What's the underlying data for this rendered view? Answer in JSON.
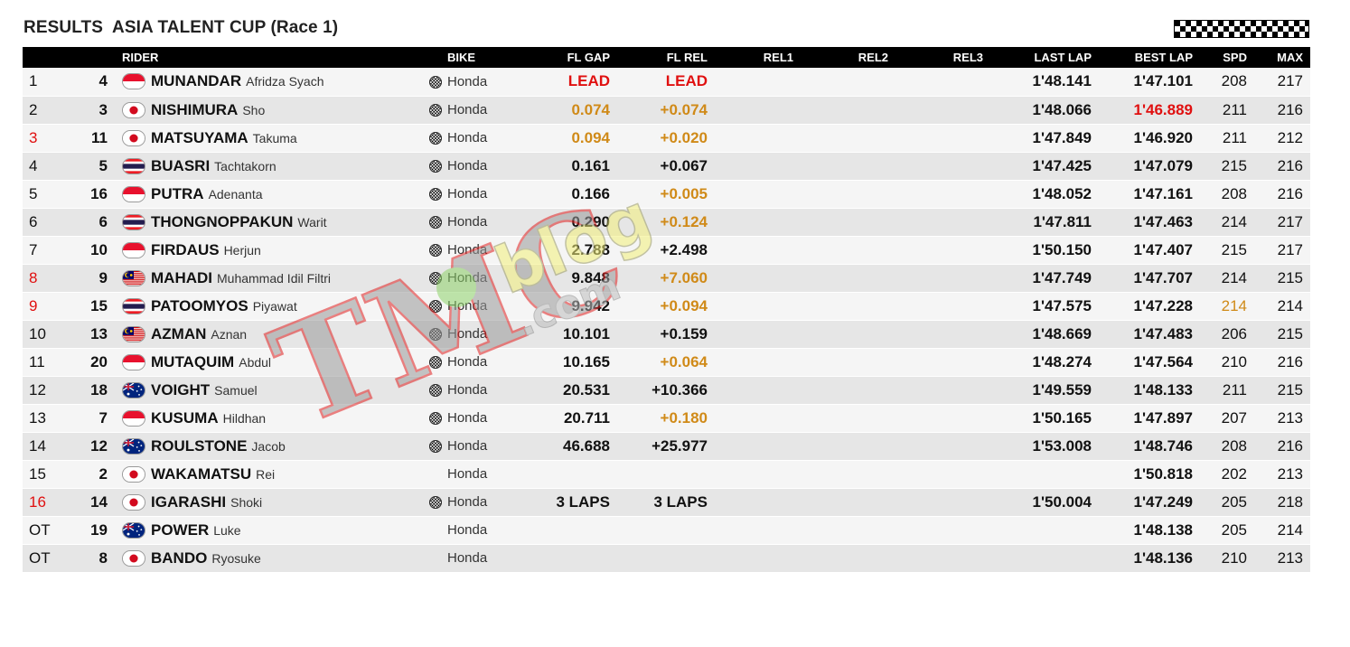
{
  "header": {
    "title_main": "RESULTS  ASIA TALENT CUP",
    "title_race": "(Race 1)"
  },
  "columns": {
    "rider": "RIDER",
    "bike": "BIKE",
    "fl_gap": "FL GAP",
    "fl_rel": "FL REL",
    "rel1": "REL1",
    "rel2": "REL2",
    "rel3": "REL3",
    "last_lap": "LAST LAP",
    "best_lap": "BEST LAP",
    "spd": "SPD",
    "max": "MAX"
  },
  "colors": {
    "lead_red": "#e01010",
    "improve_orange": "#d08a18",
    "header_bg": "#000000"
  },
  "rows": [
    {
      "pos": "1",
      "num": "4",
      "surname": "MUNANDAR",
      "given": "Afridza Syach",
      "nation": "indonesia",
      "bike": "Honda",
      "gap": "LEAD",
      "rel": "LEAD",
      "last": "1'48.141",
      "best": "1'47.101",
      "spd": "208",
      "max": "217"
    },
    {
      "pos": "2",
      "num": "3",
      "surname": "NISHIMURA",
      "given": "Sho",
      "nation": "japan",
      "bike": "Honda",
      "gap": "0.074",
      "rel": "+0.074",
      "last": "1'48.066",
      "best": "1'46.889",
      "spd": "211",
      "max": "216"
    },
    {
      "pos": "3",
      "num": "11",
      "surname": "MATSUYAMA",
      "given": "Takuma",
      "nation": "japan",
      "bike": "Honda",
      "gap": "0.094",
      "rel": "+0.020",
      "last": "1'47.849",
      "best": "1'46.920",
      "spd": "211",
      "max": "212"
    },
    {
      "pos": "4",
      "num": "5",
      "surname": "BUASRI",
      "given": "Tachtakorn",
      "nation": "thailand",
      "bike": "Honda",
      "gap": "0.161",
      "rel": "+0.067",
      "last": "1'47.425",
      "best": "1'47.079",
      "spd": "215",
      "max": "216"
    },
    {
      "pos": "5",
      "num": "16",
      "surname": "PUTRA",
      "given": "Adenanta",
      "nation": "indonesia",
      "bike": "Honda",
      "gap": "0.166",
      "rel": "+0.005",
      "last": "1'48.052",
      "best": "1'47.161",
      "spd": "208",
      "max": "216"
    },
    {
      "pos": "6",
      "num": "6",
      "surname": "THONGNOPPAKUN",
      "given": "Warit",
      "nation": "thailand",
      "bike": "Honda",
      "gap": "0.290",
      "rel": "+0.124",
      "last": "1'47.811",
      "best": "1'47.463",
      "spd": "214",
      "max": "217"
    },
    {
      "pos": "7",
      "num": "10",
      "surname": "FIRDAUS",
      "given": "Herjun",
      "nation": "indonesia",
      "bike": "Honda",
      "gap": "2.788",
      "rel": "+2.498",
      "last": "1'50.150",
      "best": "1'47.407",
      "spd": "215",
      "max": "217"
    },
    {
      "pos": "8",
      "num": "9",
      "surname": "MAHADI",
      "given": "Muhammad Idil Filtri",
      "nation": "malaysia",
      "bike": "Honda",
      "gap": "9.848",
      "rel": "+7.060",
      "last": "1'47.749",
      "best": "1'47.707",
      "spd": "214",
      "max": "215"
    },
    {
      "pos": "9",
      "num": "15",
      "surname": "PATOOMYOS",
      "given": "Piyawat",
      "nation": "thailand",
      "bike": "Honda",
      "gap": "9.942",
      "rel": "+0.094",
      "last": "1'47.575",
      "best": "1'47.228",
      "spd": "214",
      "max": "214"
    },
    {
      "pos": "10",
      "num": "13",
      "surname": "AZMAN",
      "given": "Aznan",
      "nation": "malaysia",
      "bike": "Honda",
      "gap": "10.101",
      "rel": "+0.159",
      "last": "1'48.669",
      "best": "1'47.483",
      "spd": "206",
      "max": "215"
    },
    {
      "pos": "11",
      "num": "20",
      "surname": "MUTAQUIM",
      "given": "Abdul",
      "nation": "indonesia",
      "bike": "Honda",
      "gap": "10.165",
      "rel": "+0.064",
      "last": "1'48.274",
      "best": "1'47.564",
      "spd": "210",
      "max": "216"
    },
    {
      "pos": "12",
      "num": "18",
      "surname": "VOIGHT",
      "given": "Samuel",
      "nation": "australia",
      "bike": "Honda",
      "gap": "20.531",
      "rel": "+10.366",
      "last": "1'49.559",
      "best": "1'48.133",
      "spd": "211",
      "max": "215"
    },
    {
      "pos": "13",
      "num": "7",
      "surname": "KUSUMA",
      "given": "Hildhan",
      "nation": "indonesia",
      "bike": "Honda",
      "gap": "20.711",
      "rel": "+0.180",
      "last": "1'50.165",
      "best": "1'47.897",
      "spd": "207",
      "max": "213"
    },
    {
      "pos": "14",
      "num": "12",
      "surname": "ROULSTONE",
      "given": "Jacob",
      "nation": "australia",
      "bike": "Honda",
      "gap": "46.688",
      "rel": "+25.977",
      "last": "1'53.008",
      "best": "1'48.746",
      "spd": "208",
      "max": "216"
    },
    {
      "pos": "15",
      "num": "2",
      "surname": "WAKAMATSU",
      "given": "Rei",
      "nation": "japan",
      "bike": "Honda",
      "gap": "",
      "rel": "",
      "last": "",
      "best": "1'50.818",
      "spd": "202",
      "max": "213"
    },
    {
      "pos": "16",
      "num": "14",
      "surname": "IGARASHI",
      "given": "Shoki",
      "nation": "japan",
      "bike": "Honda",
      "gap": "3 LAPS",
      "rel": "3 LAPS",
      "last": "1'50.004",
      "best": "1'47.249",
      "spd": "205",
      "max": "218"
    },
    {
      "pos": "OT",
      "num": "19",
      "surname": "POWER",
      "given": "Luke",
      "nation": "australia",
      "bike": "Honda",
      "gap": "",
      "rel": "",
      "last": "",
      "best": "1'48.138",
      "spd": "205",
      "max": "214"
    },
    {
      "pos": "OT",
      "num": "8",
      "surname": "BANDO",
      "given": "Ryosuke",
      "nation": "japan",
      "bike": "Honda",
      "gap": "",
      "rel": "",
      "last": "",
      "best": "1'48.136",
      "spd": "210",
      "max": "213"
    }
  ],
  "watermark": {
    "text_main": "TMC",
    "text_blog": "blog",
    "text_domain": ".com"
  }
}
